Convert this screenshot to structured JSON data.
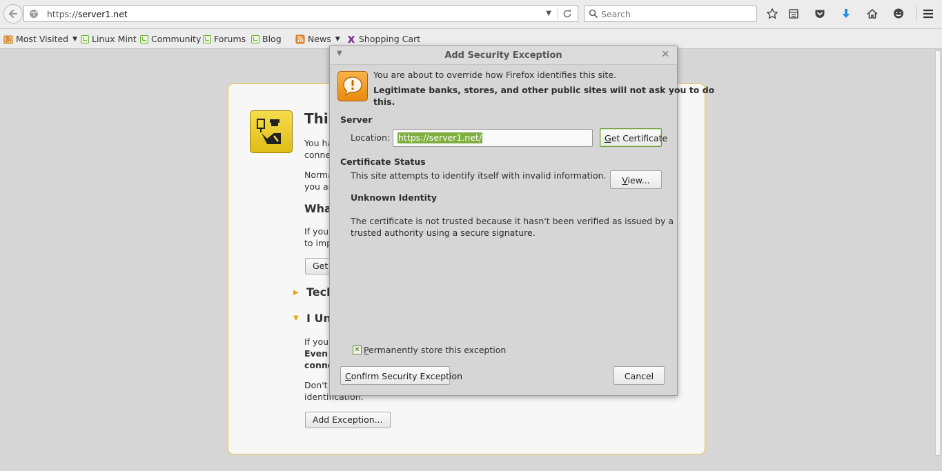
{
  "browser": {
    "url_scheme": "https://",
    "url_host": "server1.net",
    "search_placeholder": "Search"
  },
  "bookmarks": [
    {
      "label": "Most Visited",
      "icon": "rss-folder-icon",
      "has_dropdown": true
    },
    {
      "label": "Linux Mint",
      "icon": "mint-icon"
    },
    {
      "label": "Community",
      "icon": "mint-icon"
    },
    {
      "label": "Forums",
      "icon": "mint-icon"
    },
    {
      "label": "Blog",
      "icon": "mint-icon"
    },
    {
      "label": "News",
      "icon": "rss-icon",
      "has_dropdown": true
    },
    {
      "label": "Shopping Cart",
      "icon": "shopping-cart-icon"
    }
  ],
  "error_page": {
    "title_partial": "This",
    "line1a": "You ha",
    "line1b": "conne",
    "line2a": "Norma",
    "line2b": "you ar",
    "heading_what": "What",
    "line3a": "If you",
    "line3b": "to imp",
    "get_button_partial": "Get",
    "tech_partial": "Tech",
    "understand_partial": "I Un",
    "line4a": "If you",
    "line4b": "Even i",
    "line4c": "conne",
    "line5a": "Don't",
    "line5b": "identification.",
    "add_exception_label": "Add Exception..."
  },
  "dialog": {
    "title": "Add Security Exception",
    "intro": "You are about to override how Firefox identifies this site.",
    "warning_line1": "Legitimate banks, stores, and other public sites will not ask you to do",
    "warning_line2": "this.",
    "server_heading": "Server",
    "location_label": "Location:",
    "location_value": "https://server1.net/",
    "get_certificate_label": "Get Certificate",
    "cert_status_heading": "Certificate Status",
    "cert_status_text": "This site attempts to identify itself with invalid information.",
    "view_label": "View...",
    "unknown_identity_heading": "Unknown Identity",
    "untrusted_line1": "The certificate is not trusted because it hasn't been verified as issued by a",
    "untrusted_line2": "trusted authority using a secure signature.",
    "permanent_label": "Permanently store this exception",
    "permanent_checked": true,
    "confirm_label": "Confirm Security Exception",
    "cancel_label": "Cancel"
  },
  "colors": {
    "accent_green": "#7faf3f",
    "warning_orange": "#f0a235",
    "download_blue": "#2a8ee6",
    "error_border": "#f0c246"
  }
}
